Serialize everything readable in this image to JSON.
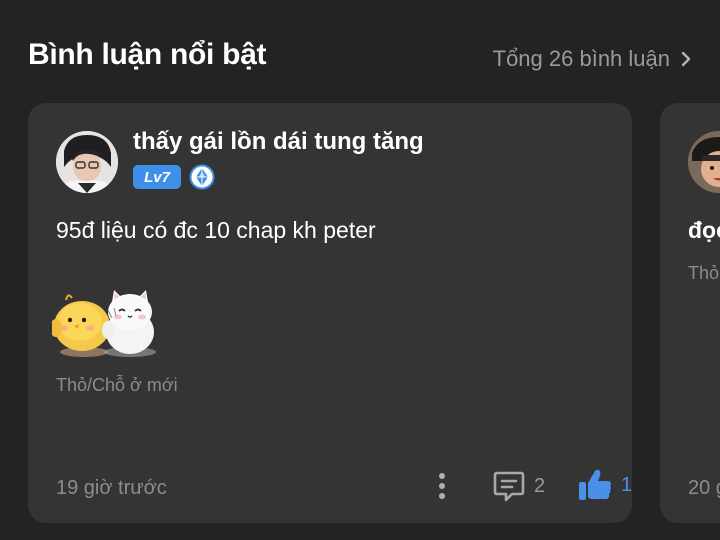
{
  "header": {
    "title": "Bình luận nổi bật",
    "total_label": "Tổng 26 bình luận"
  },
  "comments": [
    {
      "username": "thấy gái lồn dái tung tăng",
      "level": "Lv7",
      "text": "95đ liệu có đc 10 chap kh peter",
      "location": "Thỏ/Chỗ ở mới",
      "time": "19 giờ trước",
      "reply_count": "2",
      "like_count": "1"
    },
    {
      "text": "đọc",
      "location": "Thỏ",
      "time": "20 g"
    }
  ],
  "colors": {
    "background": "#232323",
    "card": "#343434",
    "accent_blue": "#3d8fe8",
    "muted_text": "#8c8c8c"
  },
  "icons": {
    "chevron": "chevron-right-icon",
    "more": "more-vertical-icon",
    "reply": "comment-icon",
    "like": "thumbs-up-icon",
    "rank": "diamond-rank-icon"
  }
}
